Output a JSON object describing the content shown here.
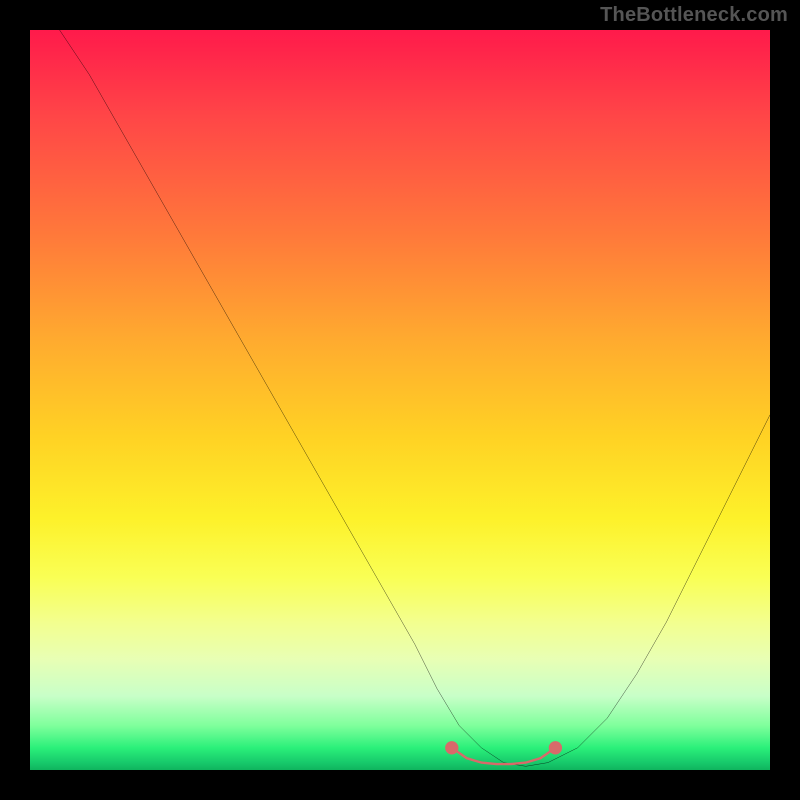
{
  "watermark": "TheBottleneck.com",
  "chart_data": {
    "type": "line",
    "title": "",
    "xlabel": "",
    "ylabel": "",
    "xlim": [
      0,
      100
    ],
    "ylim": [
      0,
      100
    ],
    "series": [
      {
        "name": "bottleneck-curve",
        "x": [
          4,
          8,
          12,
          16,
          20,
          24,
          28,
          32,
          36,
          40,
          44,
          48,
          52,
          55,
          58,
          61,
          64,
          67,
          70,
          74,
          78,
          82,
          86,
          90,
          94,
          98,
          100
        ],
        "y": [
          100,
          94,
          87,
          80,
          73,
          66,
          59,
          52,
          45,
          38,
          31,
          24,
          17,
          11,
          6,
          3,
          1,
          0.5,
          1,
          3,
          7,
          13,
          20,
          28,
          36,
          44,
          48
        ]
      },
      {
        "name": "optimal-range-marker",
        "x": [
          57,
          59,
          61,
          63,
          65,
          67,
          69,
          71
        ],
        "y": [
          3,
          1.6,
          1,
          0.8,
          0.8,
          1,
          1.6,
          3
        ]
      }
    ],
    "colors": {
      "curve": "#000000",
      "marker": "#d86a6a",
      "background_top": "#ff1a4b",
      "background_bottom": "#0fb45d"
    }
  }
}
